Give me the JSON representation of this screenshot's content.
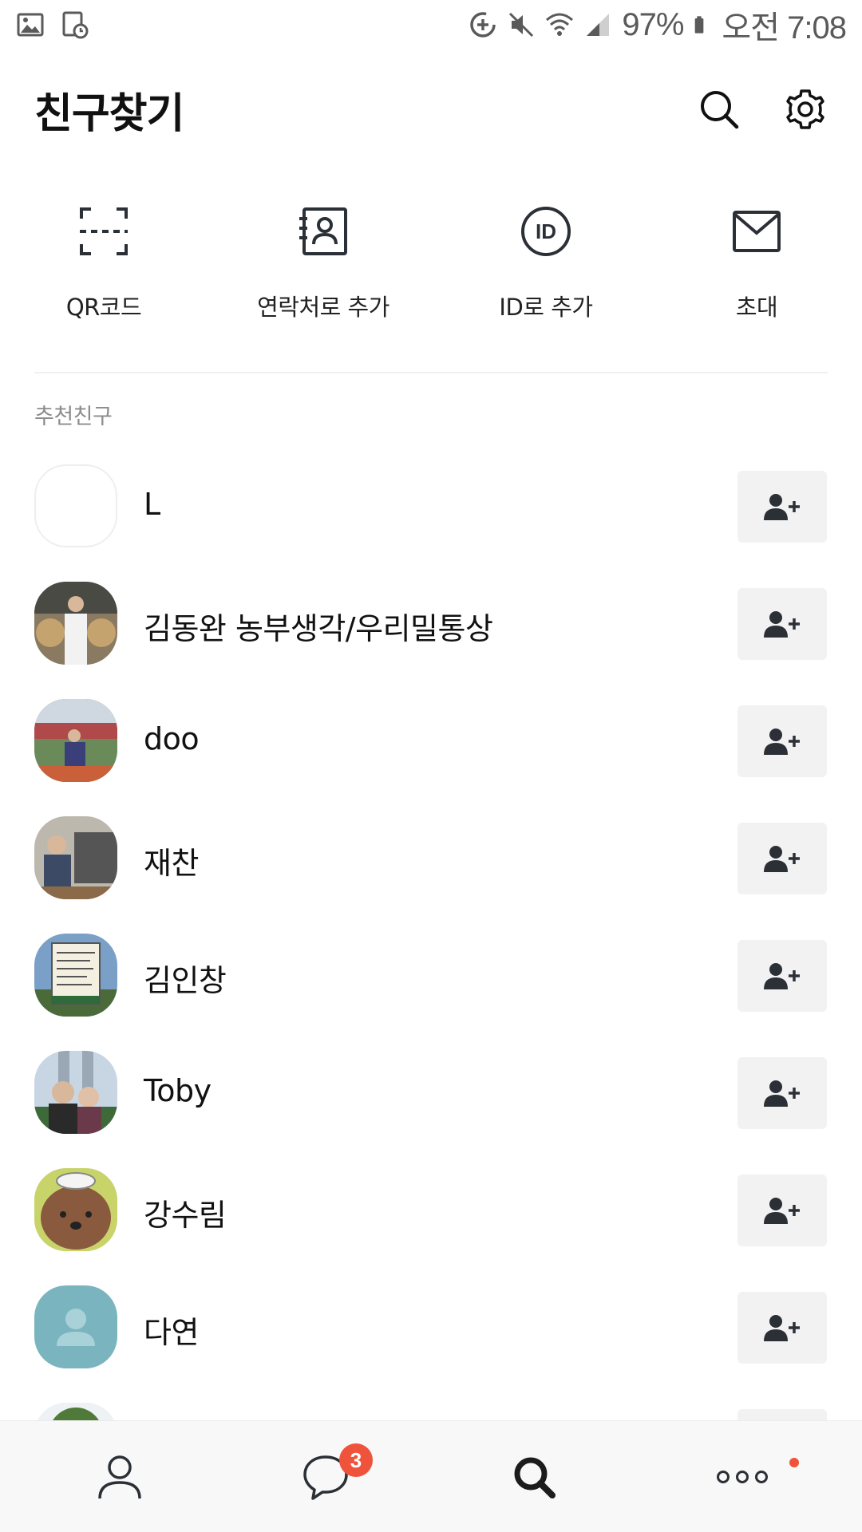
{
  "status_bar": {
    "battery_percent": "97%",
    "time": "오전 7:08",
    "icons": [
      "gallery-icon",
      "screenshot-icon",
      "data-saver-icon",
      "mute-icon",
      "wifi-icon",
      "signal-icon",
      "battery-icon"
    ]
  },
  "header": {
    "title": "친구찾기",
    "search_icon": "search-icon",
    "settings_icon": "gear-icon"
  },
  "quick_actions": [
    {
      "label": "QR코드",
      "icon": "qr-scan-icon"
    },
    {
      "label": "연락처로 추가",
      "icon": "contact-book-icon"
    },
    {
      "label": "ID로 추가",
      "icon": "id-icon"
    },
    {
      "label": "초대",
      "icon": "envelope-icon"
    }
  ],
  "recommended": {
    "section_label": "추천친구",
    "friends": [
      {
        "name": "L"
      },
      {
        "name": "김동완 농부생각/우리밀통상"
      },
      {
        "name": "doo"
      },
      {
        "name": "재찬"
      },
      {
        "name": "김인창"
      },
      {
        "name": "Toby"
      },
      {
        "name": "강수림"
      },
      {
        "name": "다연"
      },
      {
        "name": ""
      }
    ]
  },
  "bottom_nav": {
    "tabs": [
      {
        "name": "friends",
        "icon": "person-icon"
      },
      {
        "name": "chats",
        "icon": "chat-bubble-icon",
        "badge": "3"
      },
      {
        "name": "find",
        "icon": "search-icon",
        "active": true
      },
      {
        "name": "more",
        "icon": "more-dots-icon",
        "new_indicator": true
      }
    ]
  },
  "colors": {
    "accent_badge": "#f0533b",
    "button_bg": "#f2f2f2",
    "icon_dark": "#2b2f36",
    "section_label": "#8c8c8c",
    "default_avatar": "#7ab5bf"
  }
}
